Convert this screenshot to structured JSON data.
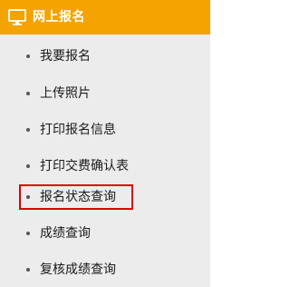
{
  "header": {
    "title": "网上报名",
    "icon": "monitor-icon",
    "background_color": "#f4a300"
  },
  "menu": {
    "items": [
      {
        "label": "我要报名"
      },
      {
        "label": "上传照片"
      },
      {
        "label": "打印报名信息"
      },
      {
        "label": "打印交费确认表"
      },
      {
        "label": "报名状态查询",
        "highlighted": true
      },
      {
        "label": "成绩查询"
      },
      {
        "label": "复核成绩查询"
      }
    ],
    "highlight_color": "#e00000"
  }
}
